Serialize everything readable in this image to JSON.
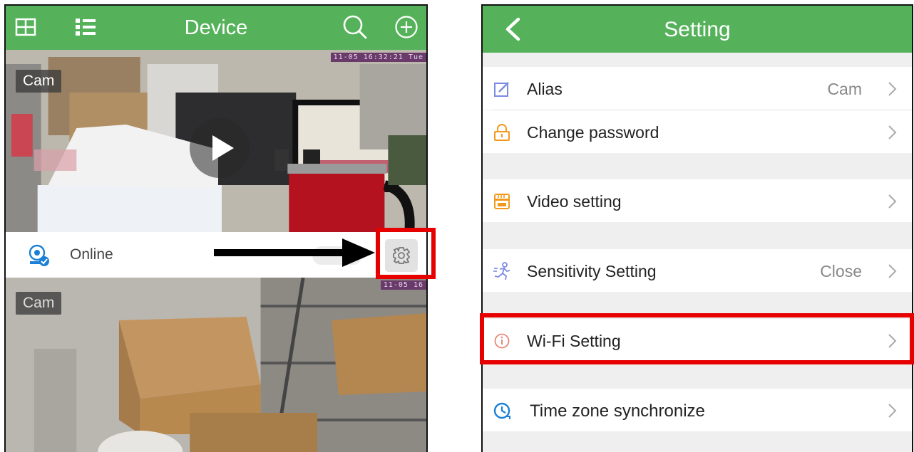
{
  "device_screen": {
    "title": "Device",
    "icons": [
      "grid-view-icon",
      "list-view-icon",
      "search-icon",
      "add-icon"
    ],
    "feeds": [
      {
        "tag": "Cam",
        "timestamp": "11-05 16:32:21 Tue"
      },
      {
        "tag": "Cam",
        "timestamp": "11-05 16"
      }
    ],
    "status": {
      "text": "Online",
      "icon": "camera-online-icon"
    },
    "settings_icon": "gear-icon"
  },
  "settings_screen": {
    "title": "Setting",
    "back_icon": "chevron-left-icon",
    "items": [
      {
        "label": "Alias",
        "value": "Cam",
        "icon": "edit-icon"
      },
      {
        "label": "Change password",
        "value": "",
        "icon": "lock-icon"
      },
      {
        "label": "Video setting",
        "value": "",
        "icon": "sd-card-icon"
      },
      {
        "label": "Sensitivity Setting",
        "value": "Close",
        "icon": "running-person-icon"
      },
      {
        "label": "Wi-Fi Setting",
        "value": "",
        "icon": "info-icon"
      },
      {
        "label": "Time zone synchronize",
        "value": "",
        "icon": "clock-icon"
      }
    ]
  },
  "colors": {
    "header_green": "#55b25a",
    "highlight_red": "#e60000",
    "icon_blue": "#1a7fd6",
    "icon_orange": "#f39a1e",
    "icon_pink": "#e8877a",
    "icon_purple": "#7b8ae3"
  }
}
